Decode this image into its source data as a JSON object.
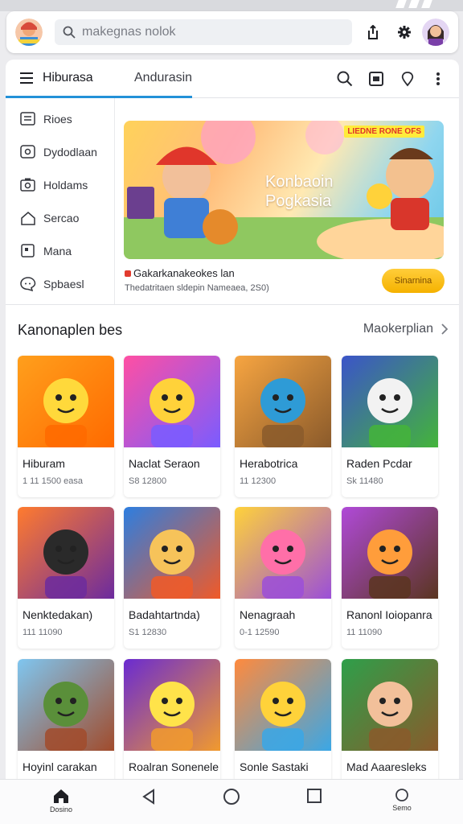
{
  "search": {
    "placeholder": "makegnas nolok"
  },
  "tabs": [
    {
      "label": "Hiburasa",
      "active": true
    },
    {
      "label": "Andurasin",
      "active": false
    }
  ],
  "sidebar": {
    "items": [
      {
        "label": "Rioes",
        "icon": "list-icon"
      },
      {
        "label": "Dydodlaan",
        "icon": "chat-box-icon"
      },
      {
        "label": "Holdams",
        "icon": "camera-icon"
      },
      {
        "label": "Sercao",
        "icon": "home-icon"
      },
      {
        "label": "Mana",
        "icon": "square-icon"
      },
      {
        "label": "Spbaesl",
        "icon": "message-icon"
      }
    ]
  },
  "banner": {
    "title": "Konbaoin Pogkasia",
    "badge": "LIEDNE RONE OFS",
    "caption": "Gakarkanakeokes lan",
    "subcaption": "Thedatritaen sldepin Nameaea, 2S0)",
    "cta_label": "Sinarnina"
  },
  "section": {
    "title": "Kanonaplen bes",
    "more_label": "Maokerplian"
  },
  "games": [
    {
      "name": "Hiburam",
      "meta": "1 11 1500 easa",
      "tag": "",
      "pill": ""
    },
    {
      "name": "Naclat Seraon",
      "meta": "S8 12800",
      "tag": "",
      "pill": ""
    },
    {
      "name": "Herabotrica",
      "meta": "11 12300",
      "tag": "",
      "pill": ""
    },
    {
      "name": "Raden Pcdar",
      "meta": "Sk 11480",
      "tag": "",
      "pill": ""
    },
    {
      "name": "Nenktedakan)",
      "meta": "111 11090",
      "tag": "",
      "pill": ""
    },
    {
      "name": "Badahtartnda)",
      "meta": "S1 12830",
      "tag": "",
      "pill": ""
    },
    {
      "name": "Nenagraah",
      "meta": "0-1 12590",
      "tag": "",
      "pill": ""
    },
    {
      "name": "Ranonl Ioiopanra",
      "meta": "11 11090",
      "tag": "",
      "pill": ""
    },
    {
      "name": "Hoyinl carakan",
      "meta": "",
      "tag": "",
      "pill": ""
    },
    {
      "name": "Roalran Sonenele",
      "meta": "",
      "tag": "",
      "pill": ""
    },
    {
      "name": "Sonle Sastaki",
      "meta": "",
      "tag": "",
      "pill": ""
    },
    {
      "name": "Mad Aaaresleks",
      "meta": "",
      "tag": "",
      "pill": ""
    }
  ],
  "bottom_nav": [
    {
      "label": "Dosino",
      "icon": "home-icon",
      "active": true
    },
    {
      "label": "",
      "icon": "back-triangle-icon"
    },
    {
      "label": "",
      "icon": "home-circle-icon"
    },
    {
      "label": "",
      "icon": "recents-square-icon"
    },
    {
      "label": "Semo",
      "icon": "circle-icon"
    }
  ],
  "colors": {
    "accent": "#2391d8",
    "cta": "#f5b200",
    "badge": "#e53935"
  }
}
